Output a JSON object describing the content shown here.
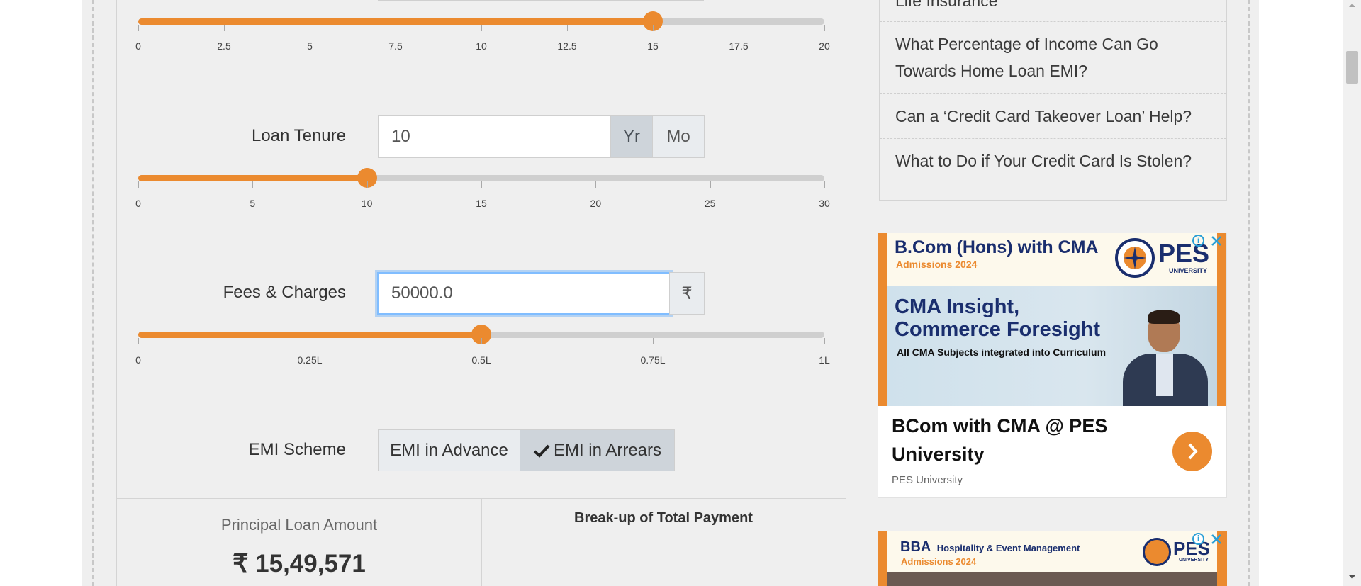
{
  "interest_slider": {
    "ticks": [
      "0",
      "2.5",
      "5",
      "7.5",
      "10",
      "12.5",
      "15",
      "17.5",
      "20"
    ],
    "value": 15,
    "min": 0,
    "max": 20
  },
  "loan_tenure": {
    "label": "Loan Tenure",
    "value": "10",
    "unit_year": "Yr",
    "unit_month": "Mo",
    "ticks": [
      "0",
      "5",
      "10",
      "15",
      "20",
      "25",
      "30"
    ],
    "slider_value": 10,
    "min": 0,
    "max": 30
  },
  "fees": {
    "label": "Fees & Charges",
    "value": "50000.0",
    "currency_addon": "₹",
    "ticks": [
      "0",
      "0.25L",
      "0.5L",
      "0.75L",
      "1L"
    ],
    "slider_value": 0.5,
    "min": 0,
    "max": 1
  },
  "emi_scheme": {
    "label": "EMI Scheme",
    "option_advance": "EMI in Advance",
    "option_arrears": "EMI in Arrears",
    "selected": "EMI in Arrears"
  },
  "results": {
    "principal_label": "Principal Loan Amount",
    "principal_value": "₹ 15,49,571",
    "breakup_title": "Break-up of Total Payment"
  },
  "sidebar": {
    "links": [
      "Life Insurance",
      "What Percentage of Income Can Go Towards Home Loan EMI?",
      "Can a ‘Credit Card Takeover Loan’ Help?",
      "What to Do if Your Credit Card Is Stolen?"
    ]
  },
  "ad1": {
    "headline": "B.Com (Hons) with CMA",
    "subline": "Admissions 2024",
    "brand": "PES",
    "brand_sub": "UNIVERSITY",
    "banner_line1": "CMA Insight,",
    "banner_line2": "Commerce Foresight",
    "banner_line3": "All CMA Subjects integrated into Curriculum",
    "title": "BCom with CMA @ PES University",
    "advertiser": "PES University",
    "info_icon": "info-icon",
    "close_icon": "close-icon"
  },
  "ad2": {
    "headline": "BBA",
    "headline_rest": "Hospitality & Event Management",
    "subline": "Admissions 2024",
    "brand": "PES",
    "brand_sub": "UNIVERSITY"
  },
  "colors": {
    "accent": "#eb8a2f",
    "track": "#cfcfcf",
    "active_addon": "#ced4da"
  }
}
